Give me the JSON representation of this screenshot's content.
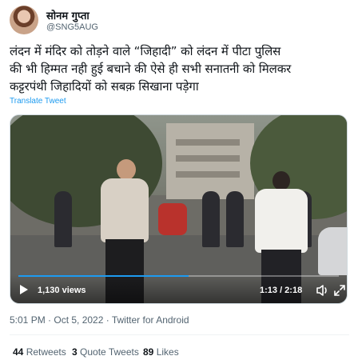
{
  "author": {
    "name": "सोनम गुप्ता",
    "handle": "@SNG5AUG"
  },
  "tweet": {
    "line1": "लंदन में मंदिर को तोड़ने वाले “जिहादी” को लंदन में पीटा पुलिस",
    "line2": "की भी हिम्मत नही हुई बचाने की ऐसे ही सभी सनातनी को मिलकर",
    "line3": "कट्टरपंथी जिहादियों को सबक़ सिखाना पड़ेगा",
    "translate_label": "Translate Tweet"
  },
  "video": {
    "views": "1,130 views",
    "time": "1:13 / 2:18",
    "progress": 0.53
  },
  "meta": {
    "timestamp": "5:01 PM · Oct 5, 2022 · Twitter for Android"
  },
  "stats": {
    "retweets_count": "44",
    "retweets_label": "Retweets",
    "quotes_count": "3",
    "quotes_label": "Quote Tweets",
    "likes_count": "89",
    "likes_label": "Likes"
  },
  "icons": {
    "play": "play-icon",
    "volume": "volume-icon",
    "fullscreen": "expand-icon"
  },
  "colors": {
    "accent": "#1d9bf0",
    "secondary_text": "#536471",
    "primary_text": "#0f1419"
  }
}
